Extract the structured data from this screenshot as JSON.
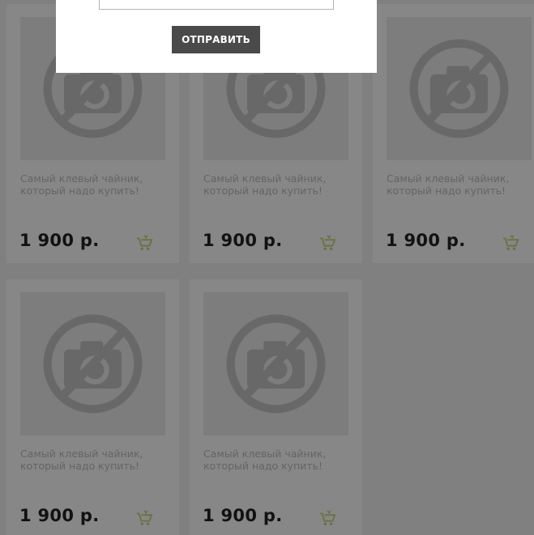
{
  "form": {
    "input_value": "",
    "submit_label": "ОТПРАВИТЬ"
  },
  "products": [
    {
      "title_line1": "Самый клевый чайник,",
      "title_line2": "который надо купить!",
      "price": "1 900 р.",
      "image_icon": "no-photo-icon",
      "cart_icon": "cart-icon"
    },
    {
      "title_line1": "Самый клевый чайник,",
      "title_line2": "который надо купить!",
      "price": "1 900 р.",
      "image_icon": "no-photo-icon",
      "cart_icon": "cart-icon"
    },
    {
      "title_line1": "Самый клевый чайник,",
      "title_line2": "который надо купить!",
      "price": "1 900 р.",
      "image_icon": "no-photo-icon",
      "cart_icon": "cart-icon"
    },
    {
      "title_line1": "Самый клевый чайник,",
      "title_line2": "который надо купить!",
      "price": "1 900 р.",
      "image_icon": "no-photo-icon",
      "cart_icon": "cart-icon"
    },
    {
      "title_line1": "Самый клевый чайник,",
      "title_line2": "который надо купить!",
      "price": "1 900 р.",
      "image_icon": "no-photo-icon",
      "cart_icon": "cart-icon"
    }
  ],
  "colors": {
    "overlay": "#000000",
    "price_text": "#222222",
    "title_text": "#bdbdbd",
    "button_bg": "#4a4a4a",
    "cart_icon": "#c8d67a"
  }
}
